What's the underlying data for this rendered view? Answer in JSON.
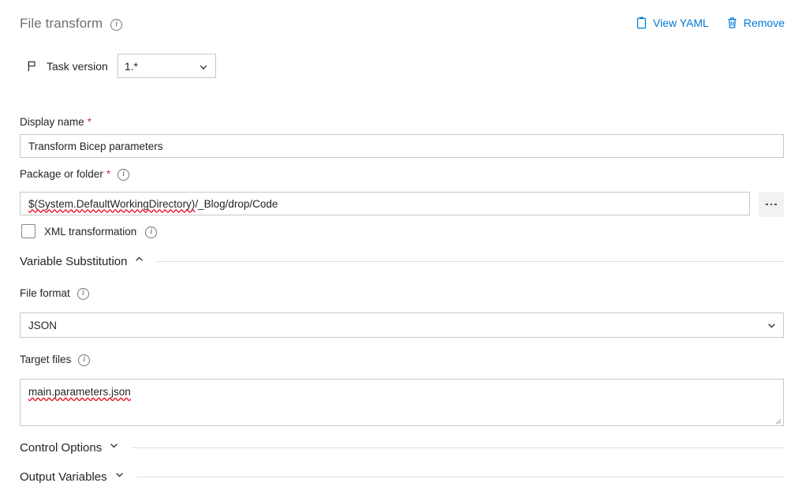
{
  "header": {
    "title": "File transform",
    "info_icon": "info-icon",
    "actions": [
      {
        "label": "View YAML",
        "icon": "clipboard-icon"
      },
      {
        "label": "Remove",
        "icon": "trash-icon"
      }
    ]
  },
  "task_version": {
    "icon": "flag-icon",
    "label": "Task version",
    "value": "1.*",
    "chevron": "chevron-down-icon"
  },
  "fields": {
    "display_name": {
      "label": "Display name",
      "required": "*",
      "value": "Transform Bicep parameters"
    },
    "package_or_folder": {
      "label": "Package or folder",
      "required": "*",
      "info_icon": "info-icon",
      "value": "$(System.DefaultWorkingDirectory)/_Blog/drop/Code",
      "value_misspelled": "$(System.DefaultWorkingDirectory)",
      "value_rest": "/_Blog/drop/Code",
      "browse_label": "..."
    },
    "xml_transformation": {
      "label": "XML transformation",
      "checked": false,
      "info_icon": "info-icon"
    },
    "file_format": {
      "label": "File format",
      "info_icon": "info-icon",
      "value": "JSON",
      "chevron": "chevron-down-icon"
    },
    "target_files": {
      "label": "Target files",
      "info_icon": "info-icon",
      "value": "main.parameters.json"
    }
  },
  "sections": [
    {
      "title": "Variable Substitution",
      "expanded": true,
      "chevron": "chevron-up-icon"
    },
    {
      "title": "Control Options",
      "expanded": false,
      "chevron": "chevron-down-icon"
    },
    {
      "title": "Output Variables",
      "expanded": false,
      "chevron": "chevron-down-icon"
    }
  ],
  "colors": {
    "accent": "#0078d4",
    "required": "#c4314b",
    "title": "#6e6e6e",
    "text": "#242424",
    "border": "#c8c8c8",
    "spellcheck": "#e81123"
  }
}
